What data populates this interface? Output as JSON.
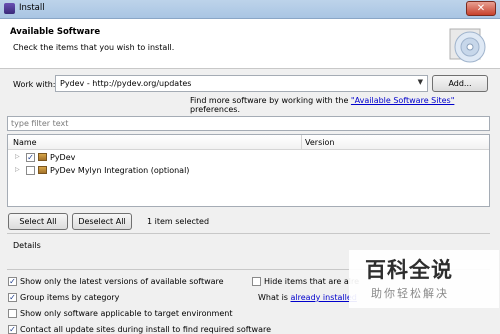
{
  "window": {
    "title": "Install"
  },
  "header": {
    "title": "Available Software",
    "subtitle": "Check the items that you wish to install."
  },
  "work_with": {
    "label": "Work with:",
    "value": "Pydev - http://pydev.org/updates",
    "add_label": "Add..."
  },
  "find_more": {
    "prefix": "Find more software by working with the ",
    "link": "\"Available Software Sites\"",
    "suffix": " preferences."
  },
  "filter": {
    "placeholder": "type filter text"
  },
  "table": {
    "columns": [
      "Name",
      "Version"
    ],
    "rows": [
      {
        "name": "PyDev",
        "checked": true
      },
      {
        "name": "PyDev Mylyn Integration (optional)",
        "checked": false
      }
    ]
  },
  "selection": {
    "select_all": "Select All",
    "deselect_all": "Deselect All",
    "count": "1 item selected"
  },
  "details": {
    "label": "Details"
  },
  "options": {
    "latest_versions": "Show only the latest versions of available software",
    "hide_installed": "Hide items that are alre",
    "group_by_category": "Group items by category",
    "what_is_prefix": "What is ",
    "already_installed_link": "already installed",
    "applicable_only": "Show only software applicable to target environment",
    "contact_sites": "Contact all update sites during install to find required software"
  },
  "watermark": {
    "title": "百科全说",
    "subtitle": "助你轻松解决"
  }
}
